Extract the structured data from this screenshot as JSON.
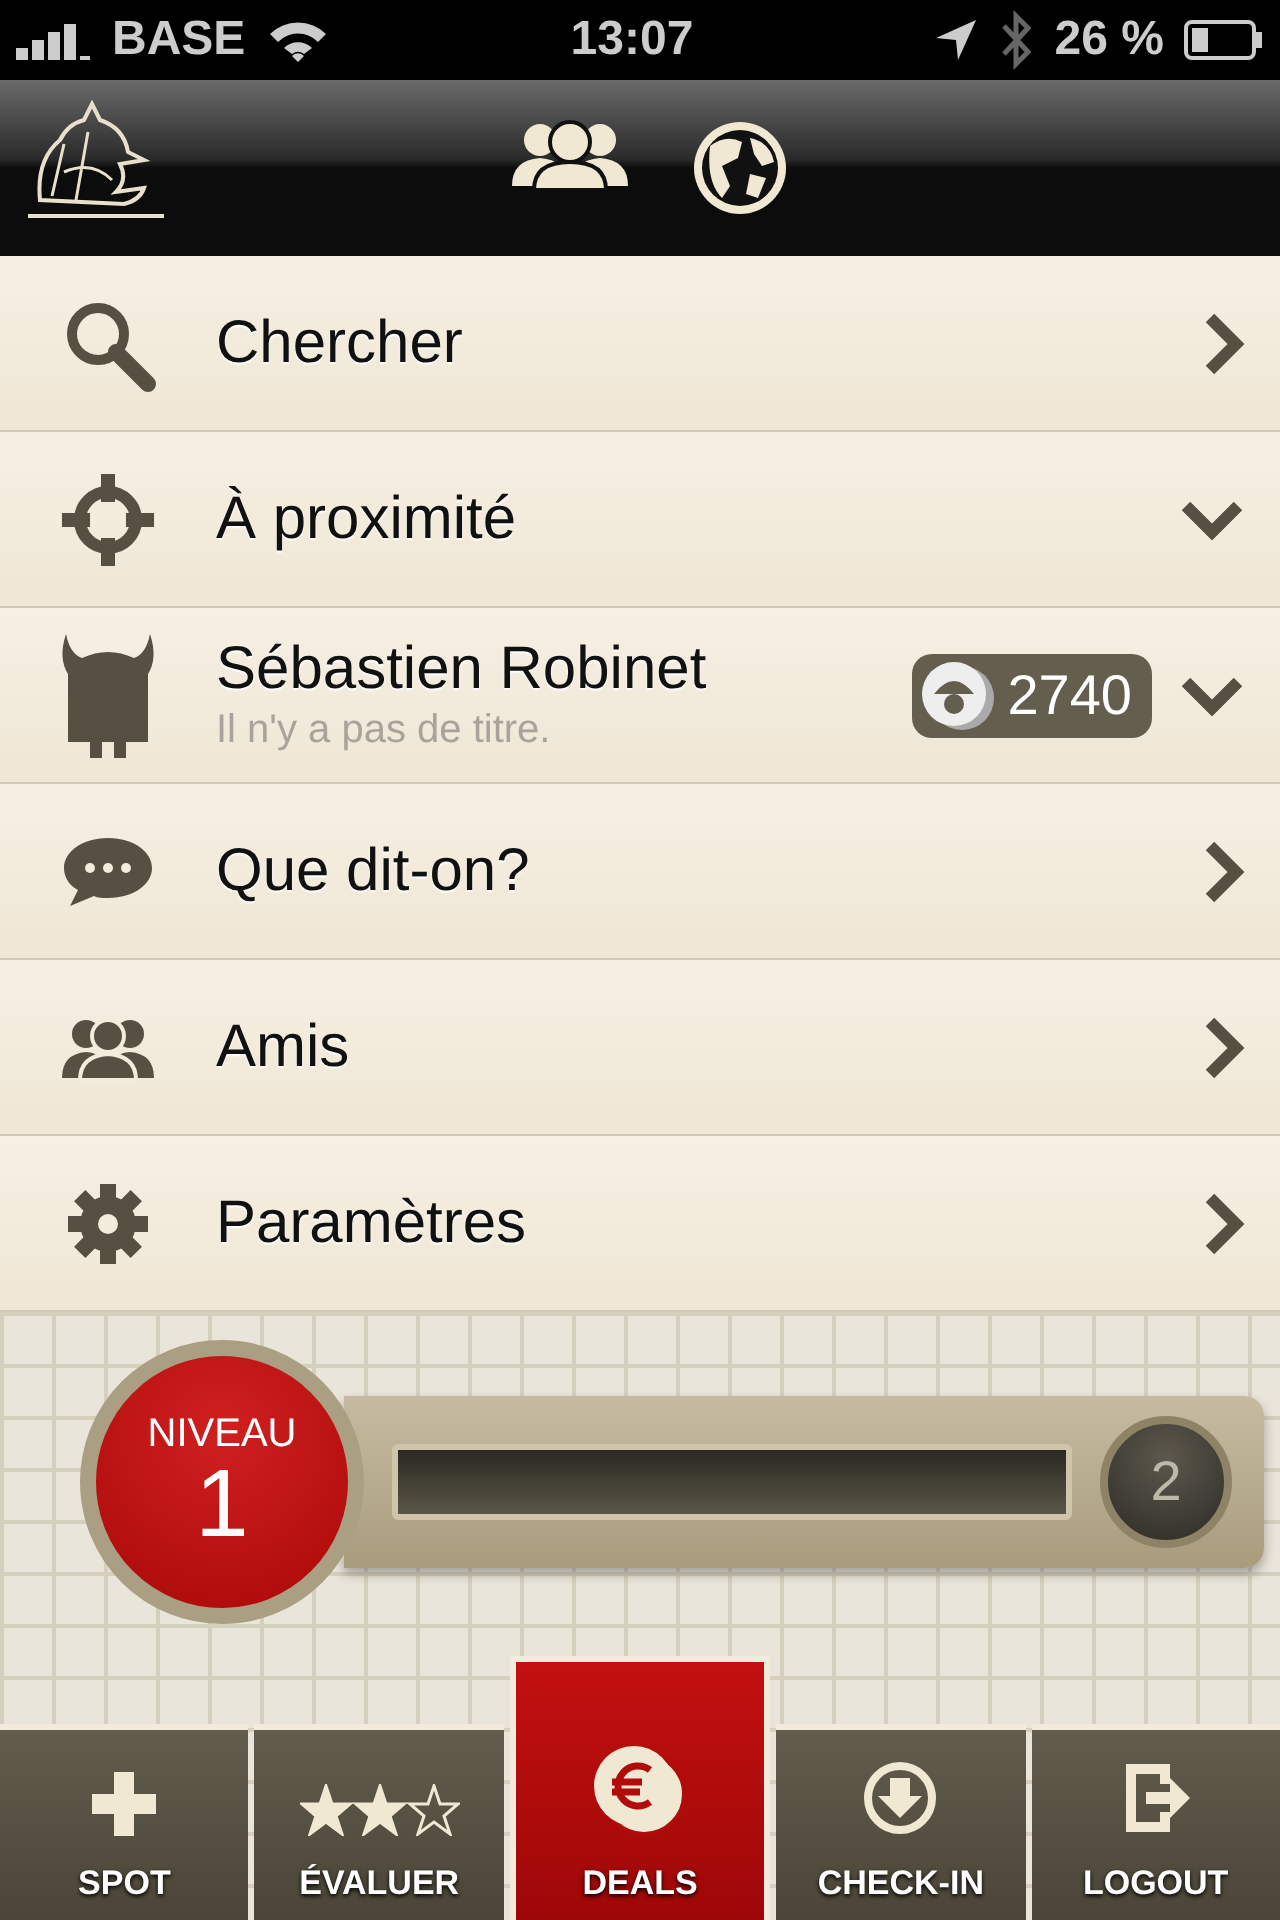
{
  "status_bar": {
    "carrier": "BASE",
    "time": "13:07",
    "battery": "26 %"
  },
  "menu": [
    {
      "kind": "link",
      "label": "Chercher"
    },
    {
      "kind": "section",
      "label": "À proximité"
    },
    {
      "kind": "profile",
      "label": "Sébastien Robinet",
      "subtitle": "Il n'y a pas de titre.",
      "points": "2740"
    },
    {
      "kind": "link",
      "label": "Que dit-on?"
    },
    {
      "kind": "link",
      "label": "Amis"
    },
    {
      "kind": "link",
      "label": "Paramètres"
    }
  ],
  "level": {
    "caption": "NIVEAU",
    "current": "1",
    "next": "2",
    "level": 0
  },
  "tabs": [
    {
      "label": "SPOT",
      "selected": false
    },
    {
      "label": "ÉVALUER",
      "selected": false
    },
    {
      "label": "DEALS",
      "selected": true
    },
    {
      "label": "CHECK-IN",
      "selected": false
    },
    {
      "label": "LOGOUT",
      "selected": false
    }
  ]
}
